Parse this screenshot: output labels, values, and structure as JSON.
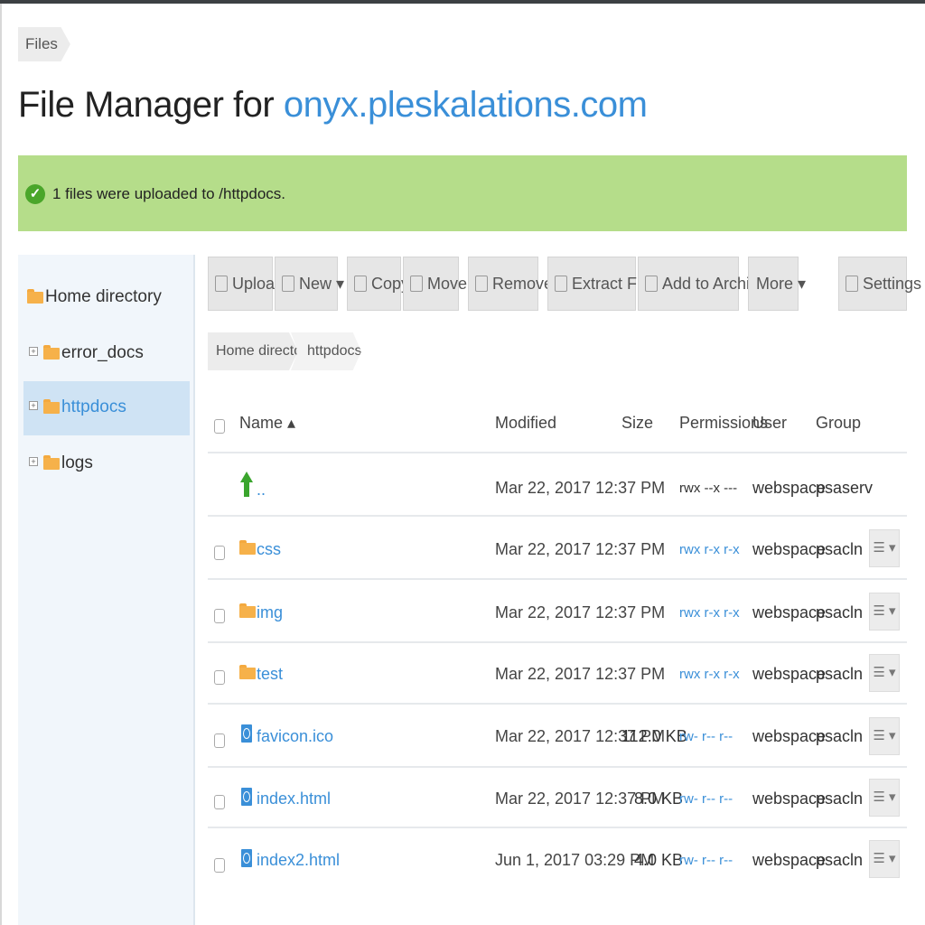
{
  "breadcrumb": {
    "root": "Files"
  },
  "title": {
    "prefix": "File Manager for",
    "domain": "onyx.pleskalations.com"
  },
  "alert": {
    "message": "1 files were uploaded to /httpdocs."
  },
  "sidebar": {
    "items": [
      {
        "label": "Home directory"
      },
      {
        "label": "error_docs",
        "expander": "+"
      },
      {
        "label": "httpdocs",
        "expander": "+"
      },
      {
        "label": "logs",
        "expander": "+"
      }
    ]
  },
  "toolbar": {
    "upload": "Upload",
    "new": "New ▾",
    "copy": "Copy",
    "move": "Move",
    "remove": "Remove",
    "extract": "Extract Files",
    "archive": "Add to Archive",
    "more": "More ▾",
    "settings": "Settings"
  },
  "path": {
    "home": "Home directory",
    "current": "httpdocs"
  },
  "table": {
    "columns": {
      "name": "Name ▴",
      "modified": "Modified",
      "size": "Size",
      "permissions": "Permissions",
      "user": "User",
      "group": "Group"
    },
    "rows": [
      {
        "name": "..",
        "modified": "Mar 22, 2017 12:37 PM",
        "size": "",
        "permissions": "rwx --x ---",
        "user": "webspace",
        "group": "psaserv"
      },
      {
        "name": "css",
        "modified": "Mar 22, 2017 12:37 PM",
        "size": "",
        "permissions": "rwx r-x r-x",
        "user": "webspace",
        "group": "psacln"
      },
      {
        "name": "img",
        "modified": "Mar 22, 2017 12:37 PM",
        "size": "",
        "permissions": "rwx r-x r-x",
        "user": "webspace",
        "group": "psacln"
      },
      {
        "name": "test",
        "modified": "Mar 22, 2017 12:37 PM",
        "size": "",
        "permissions": "rwx r-x r-x",
        "user": "webspace",
        "group": "psacln"
      },
      {
        "name": "favicon.ico",
        "modified": "Mar 22, 2017 12:37 PM",
        "size": "112.0 KB",
        "permissions": "rw- r-- r--",
        "user": "webspace",
        "group": "psacln"
      },
      {
        "name": "index.html",
        "modified": "Mar 22, 2017 12:37 PM",
        "size": "8.0 KB",
        "permissions": "rw- r-- r--",
        "user": "webspace",
        "group": "psacln"
      },
      {
        "name": "index2.html",
        "modified": "Jun 1, 2017 03:29 PM",
        "size": "4.0 KB",
        "permissions": "rw- r-- r--",
        "user": "webspace",
        "group": "psacln"
      }
    ],
    "row_menu": "☰ ▾"
  }
}
